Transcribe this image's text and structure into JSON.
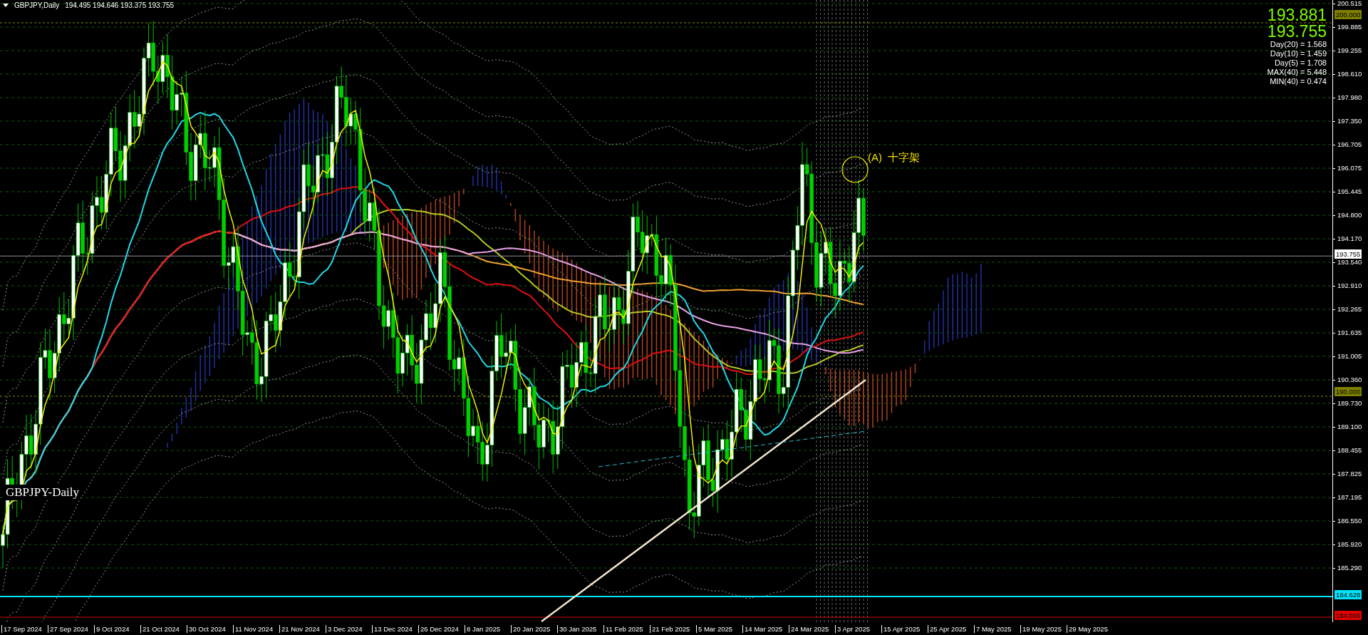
{
  "header": {
    "symbol": "GBPJPY,Daily",
    "ohlc": "194.495 194.646 193.375 193.755"
  },
  "price_info": {
    "bid": "193.881",
    "close": "193.755",
    "stats": [
      "Day(20) = 1.568",
      "Day(10) = 1.459",
      "Day(5) = 1.708",
      "MAX(40) = 5.448",
      "MIN(40) = 0.474"
    ]
  },
  "annotation": "(A)  十字架",
  "chart_label": "GBPJPY-Daily",
  "price_axis": {
    "labels": [
      "200.515",
      "199.885",
      "199.255",
      "198.610",
      "197.980",
      "197.350",
      "196.705",
      "196.075",
      "195.445",
      "194.800",
      "194.170",
      "193.540",
      "192.910",
      "192.265",
      "191.635",
      "191.005",
      "190.360",
      "189.730",
      "189.100",
      "188.455",
      "187.825",
      "187.195",
      "186.550",
      "185.920",
      "185.290"
    ],
    "markers": [
      {
        "text": "200.000",
        "kind": "level"
      },
      {
        "text": "193.755",
        "kind": "current"
      },
      {
        "text": "190.000",
        "kind": "level"
      },
      {
        "text": "184.628",
        "kind": "line"
      },
      {
        "text": "184.065",
        "kind": "alert"
      }
    ]
  },
  "date_axis": [
    "17 Sep 2024",
    "27 Sep 2024",
    "9 Oct 2024",
    "21 Oct 2024",
    "30 Oct 2024",
    "11 Nov 2024",
    "21 Nov 2024",
    "3 Dec 2024",
    "13 Dec 2024",
    "26 Dec 2024",
    "8 Jan 2025",
    "20 Jan 2025",
    "30 Jan 2025",
    "11 Feb 2025",
    "21 Feb 2025",
    "5 Mar 2025",
    "14 Mar 2025",
    "24 Mar 2025",
    "3 Apr 2025",
    "15 Apr 2025",
    "25 Apr 2025",
    "7 May 2025",
    "19 May 2025",
    "29 May 2025"
  ]
}
